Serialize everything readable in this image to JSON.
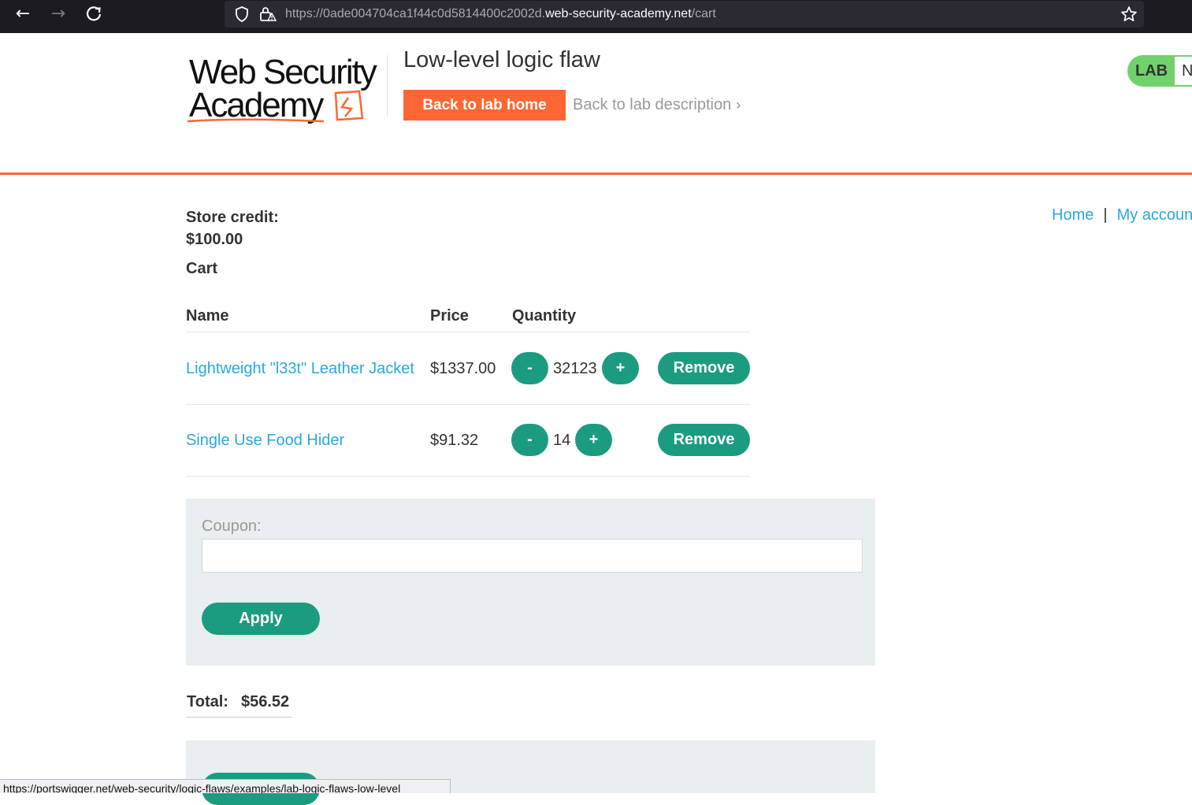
{
  "browser": {
    "url_prefix": "https://0ade004704ca1f44c0d5814400c2002d.",
    "url_host": "web-security-academy.net",
    "url_path": "/cart",
    "status_url": "https://portswigger.net/web-security/logic-flaws/examples/lab-logic-flaws-low-level"
  },
  "header": {
    "logo_line1": "Web Security",
    "logo_line2": "Academy",
    "lab_title": "Low-level logic flaw",
    "back_home": "Back to lab home",
    "back_description": "Back to lab description",
    "lab_badge": "LAB",
    "lab_status": "N"
  },
  "nav": {
    "home": "Home",
    "separator": "|",
    "account": "My account"
  },
  "store_credit": {
    "label": "Store credit:",
    "value": "$100.00"
  },
  "cart": {
    "title": "Cart",
    "columns": [
      "Name",
      "Price",
      "Quantity"
    ],
    "items": [
      {
        "name": "Lightweight \"l33t\" Leather Jacket",
        "price": "$1337.00",
        "minus": "-",
        "quantity": "32123",
        "plus": "+",
        "remove": "Remove"
      },
      {
        "name": "Single Use Food Hider",
        "price": "$91.32",
        "minus": "-",
        "quantity": "14",
        "plus": "+",
        "remove": "Remove"
      }
    ]
  },
  "coupon": {
    "label": "Coupon:",
    "value": "",
    "apply": "Apply"
  },
  "total": {
    "label": "Total:",
    "value": "$56.52"
  },
  "colors": {
    "accent_orange": "#ff6633",
    "button_green": "#1b9c81",
    "link_blue": "#29a8df",
    "badge_green": "#70d16d"
  }
}
